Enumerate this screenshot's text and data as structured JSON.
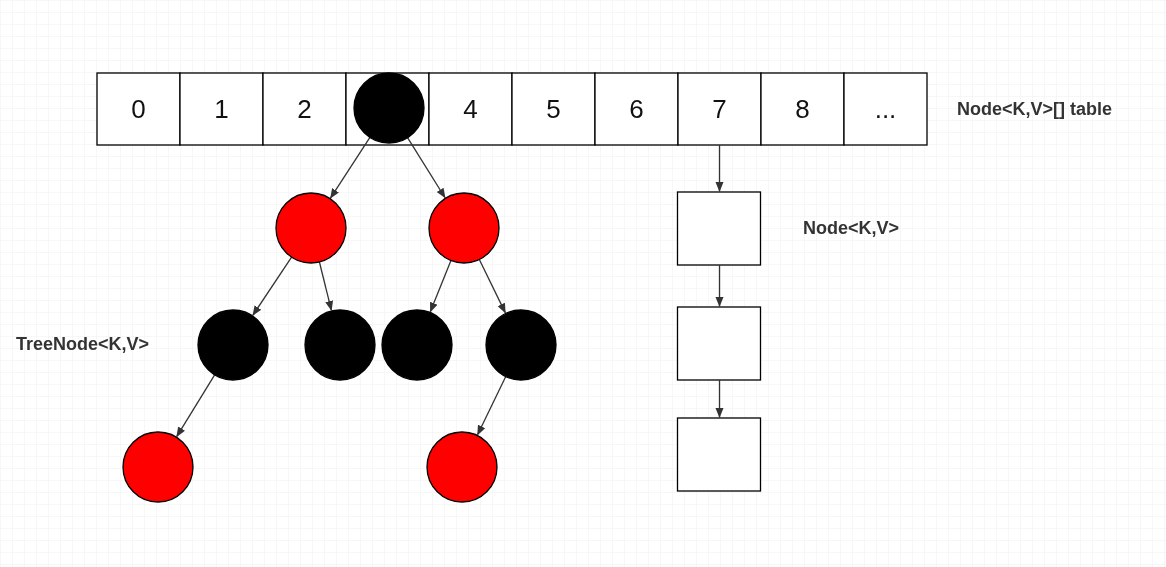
{
  "table": {
    "label": "Node<K,V>[] table",
    "cells": [
      {
        "kind": "value",
        "label": "0"
      },
      {
        "kind": "value",
        "label": "1"
      },
      {
        "kind": "value",
        "label": "2"
      },
      {
        "kind": "tree"
      },
      {
        "kind": "value",
        "label": "4"
      },
      {
        "kind": "value",
        "label": "5"
      },
      {
        "kind": "value",
        "label": "6"
      },
      {
        "kind": "value",
        "label": "7",
        "chain": true
      },
      {
        "kind": "value",
        "label": "8"
      },
      {
        "kind": "value",
        "label": "..."
      }
    ]
  },
  "tree": {
    "label": "TreeNode<K,V>",
    "root": {
      "color": "#000000",
      "children": [
        {
          "color": "#ff0000",
          "children": [
            {
              "color": "#000000",
              "children": [
                {
                  "color": "#ff0000"
                }
              ]
            },
            {
              "color": "#000000"
            }
          ]
        },
        {
          "color": "#ff0000",
          "children": [
            {
              "color": "#000000"
            },
            {
              "color": "#000000",
              "children": [
                {
                  "color": "#ff0000"
                }
              ]
            }
          ]
        }
      ]
    }
  },
  "list": {
    "label": "Node<K,V>",
    "nodes": [
      {
        "kind": "node"
      },
      {
        "kind": "node"
      },
      {
        "kind": "node"
      }
    ]
  }
}
